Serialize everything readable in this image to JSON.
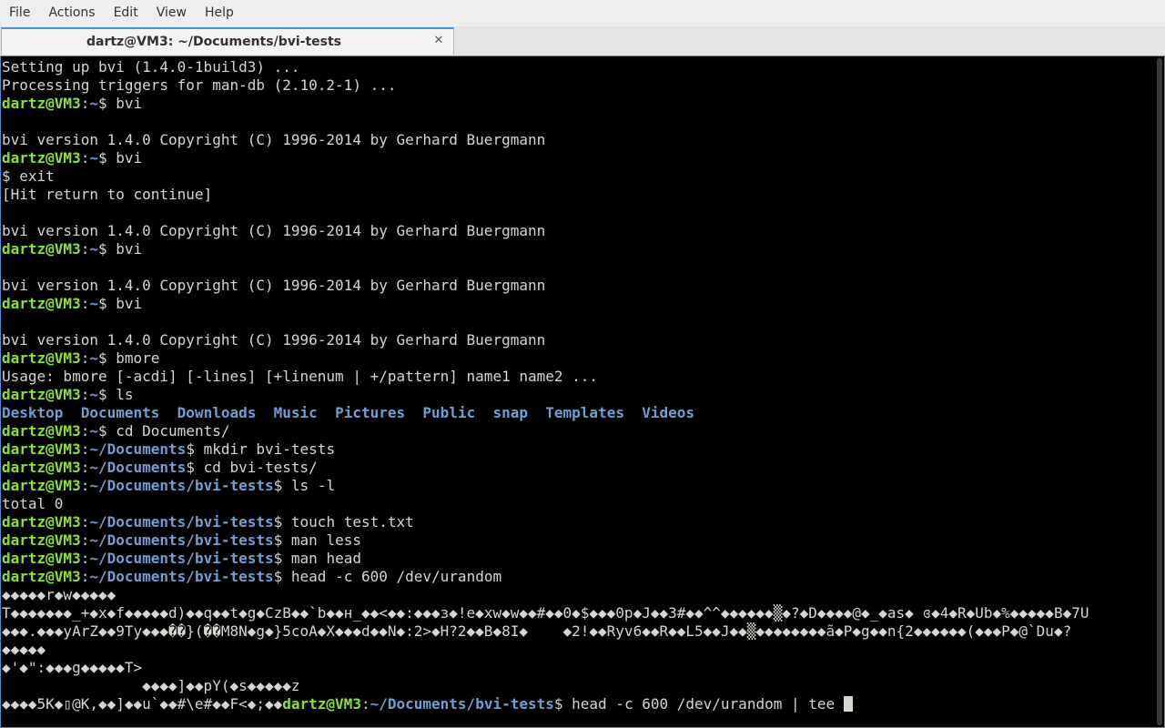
{
  "menubar": {
    "items": [
      "File",
      "Actions",
      "Edit",
      "View",
      "Help"
    ]
  },
  "tab": {
    "title": "dartz@VM3: ~/Documents/bvi-tests",
    "close_icon": "close-icon",
    "accent": "#4a90d9"
  },
  "terminal": {
    "colors": {
      "background": "#000000",
      "text": "#d3d7cf",
      "user": "#8ae234",
      "path": "#729fcf"
    },
    "lines": [
      [
        {
          "t": "text",
          "v": "Setting up bvi (1.4.0-1build3) ..."
        }
      ],
      [
        {
          "t": "text",
          "v": "Processing triggers for man-db (2.10.2-1) ..."
        }
      ],
      [
        {
          "t": "user",
          "v": "dartz@VM3"
        },
        {
          "t": "text",
          "v": ":"
        },
        {
          "t": "path",
          "v": "~"
        },
        {
          "t": "text",
          "v": "$ bvi"
        }
      ],
      [],
      [
        {
          "t": "text",
          "v": "bvi version 1.4.0 Copyright (C) 1996-2014 by Gerhard Buergmann"
        }
      ],
      [
        {
          "t": "user",
          "v": "dartz@VM3"
        },
        {
          "t": "text",
          "v": ":"
        },
        {
          "t": "path",
          "v": "~"
        },
        {
          "t": "text",
          "v": "$ bvi"
        }
      ],
      [
        {
          "t": "text",
          "v": "$ exit"
        }
      ],
      [
        {
          "t": "text",
          "v": "[Hit return to continue]"
        }
      ],
      [],
      [
        {
          "t": "text",
          "v": "bvi version 1.4.0 Copyright (C) 1996-2014 by Gerhard Buergmann"
        }
      ],
      [
        {
          "t": "user",
          "v": "dartz@VM3"
        },
        {
          "t": "text",
          "v": ":"
        },
        {
          "t": "path",
          "v": "~"
        },
        {
          "t": "text",
          "v": "$ bvi"
        }
      ],
      [],
      [
        {
          "t": "text",
          "v": "bvi version 1.4.0 Copyright (C) 1996-2014 by Gerhard Buergmann"
        }
      ],
      [
        {
          "t": "user",
          "v": "dartz@VM3"
        },
        {
          "t": "text",
          "v": ":"
        },
        {
          "t": "path",
          "v": "~"
        },
        {
          "t": "text",
          "v": "$ bvi"
        }
      ],
      [],
      [
        {
          "t": "text",
          "v": "bvi version 1.4.0 Copyright (C) 1996-2014 by Gerhard Buergmann"
        }
      ],
      [
        {
          "t": "user",
          "v": "dartz@VM3"
        },
        {
          "t": "text",
          "v": ":"
        },
        {
          "t": "path",
          "v": "~"
        },
        {
          "t": "text",
          "v": "$ bmore"
        }
      ],
      [
        {
          "t": "text",
          "v": "Usage: bmore [-acdi] [-lines] [+linenum | +/pattern] name1 name2 ..."
        }
      ],
      [
        {
          "t": "user",
          "v": "dartz@VM3"
        },
        {
          "t": "text",
          "v": ":"
        },
        {
          "t": "path",
          "v": "~"
        },
        {
          "t": "text",
          "v": "$ ls"
        }
      ],
      [
        {
          "t": "dir",
          "v": "Desktop"
        },
        {
          "t": "text",
          "v": "  "
        },
        {
          "t": "dir",
          "v": "Documents"
        },
        {
          "t": "text",
          "v": "  "
        },
        {
          "t": "dir",
          "v": "Downloads"
        },
        {
          "t": "text",
          "v": "  "
        },
        {
          "t": "dir",
          "v": "Music"
        },
        {
          "t": "text",
          "v": "  "
        },
        {
          "t": "dir",
          "v": "Pictures"
        },
        {
          "t": "text",
          "v": "  "
        },
        {
          "t": "dir",
          "v": "Public"
        },
        {
          "t": "text",
          "v": "  "
        },
        {
          "t": "dir",
          "v": "snap"
        },
        {
          "t": "text",
          "v": "  "
        },
        {
          "t": "dir",
          "v": "Templates"
        },
        {
          "t": "text",
          "v": "  "
        },
        {
          "t": "dir",
          "v": "Videos"
        }
      ],
      [
        {
          "t": "user",
          "v": "dartz@VM3"
        },
        {
          "t": "text",
          "v": ":"
        },
        {
          "t": "path",
          "v": "~"
        },
        {
          "t": "text",
          "v": "$ cd Documents/"
        }
      ],
      [
        {
          "t": "user",
          "v": "dartz@VM3"
        },
        {
          "t": "text",
          "v": ":"
        },
        {
          "t": "path",
          "v": "~/Documents"
        },
        {
          "t": "text",
          "v": "$ mkdir bvi-tests"
        }
      ],
      [
        {
          "t": "user",
          "v": "dartz@VM3"
        },
        {
          "t": "text",
          "v": ":"
        },
        {
          "t": "path",
          "v": "~/Documents"
        },
        {
          "t": "text",
          "v": "$ cd bvi-tests/"
        }
      ],
      [
        {
          "t": "user",
          "v": "dartz@VM3"
        },
        {
          "t": "text",
          "v": ":"
        },
        {
          "t": "path",
          "v": "~/Documents/bvi-tests"
        },
        {
          "t": "text",
          "v": "$ ls -l"
        }
      ],
      [
        {
          "t": "text",
          "v": "total 0"
        }
      ],
      [
        {
          "t": "user",
          "v": "dartz@VM3"
        },
        {
          "t": "text",
          "v": ":"
        },
        {
          "t": "path",
          "v": "~/Documents/bvi-tests"
        },
        {
          "t": "text",
          "v": "$ touch test.txt"
        }
      ],
      [
        {
          "t": "user",
          "v": "dartz@VM3"
        },
        {
          "t": "text",
          "v": ":"
        },
        {
          "t": "path",
          "v": "~/Documents/bvi-tests"
        },
        {
          "t": "text",
          "v": "$ man less"
        }
      ],
      [
        {
          "t": "user",
          "v": "dartz@VM3"
        },
        {
          "t": "text",
          "v": ":"
        },
        {
          "t": "path",
          "v": "~/Documents/bvi-tests"
        },
        {
          "t": "text",
          "v": "$ man head"
        }
      ],
      [
        {
          "t": "user",
          "v": "dartz@VM3"
        },
        {
          "t": "text",
          "v": ":"
        },
        {
          "t": "path",
          "v": "~/Documents/bvi-tests"
        },
        {
          "t": "text",
          "v": "$ head -c 600 /dev/urandom"
        }
      ],
      [
        {
          "t": "text",
          "v": "◆◆◆◆◆r◆w◆◆◆◆◆"
        }
      ],
      [
        {
          "t": "text",
          "v": "T◆◆◆◆◆◆◆_+◆x◆f◆◆◆◆◆d)◆◆q◆◆t◆g◆CzB◆◆`b◆◆н_◆◆<◆◆:◆◆◆з◆!e◆xw◆w◆◆#◆◆0◆$◆◆◆0p◆J◆◆3#◆◆^^◆◆◆◆◆◆▒◆?◆D◆◆◆◆@◆_◆as◆ ɞ◆4◆R◆Ub◆%◆◆◆◆◆B◆7U"
        }
      ],
      [
        {
          "t": "text",
          "v": "◆◆◆.◆◆◆yArZ◆◆9Ty◆◆◆��}(��M8N◆g◆}5coA◆X◆◆◆d◆◆N◆:2>◆H?2◆◆B◆8I◆    ◆2!◆◆Ryv6◆◆R◆◆L5◆◆J◆◆▒◆◆◆◆◆◆◆◆ã◆P◆g◆◆n{2◆◆◆◆◆◆(◆◆◆P◆@`Du◆?"
        }
      ],
      [
        {
          "t": "text",
          "v": "◆◆◆◆◆"
        }
      ],
      [
        {
          "t": "text",
          "v": "◆'◆\":◆◆◆g◆◆◆◆◆T>"
        }
      ],
      [
        {
          "t": "text",
          "v": "                ◆◆◆◆]◆◆pY(◆s◆◆◆◆◆z"
        }
      ],
      [
        {
          "t": "text",
          "v": "◆◆◆◆5K◆▯@K,◆◆]◆◆u`◆◆#\\e#◆◆F<◆;◆◆"
        },
        {
          "t": "user",
          "v": "dartz@VM3"
        },
        {
          "t": "text",
          "v": ":"
        },
        {
          "t": "path",
          "v": "~/Documents/bvi-tests"
        },
        {
          "t": "text",
          "v": "$ head -c 600 /dev/urandom | tee "
        },
        {
          "t": "cursor",
          "v": ""
        }
      ]
    ]
  }
}
